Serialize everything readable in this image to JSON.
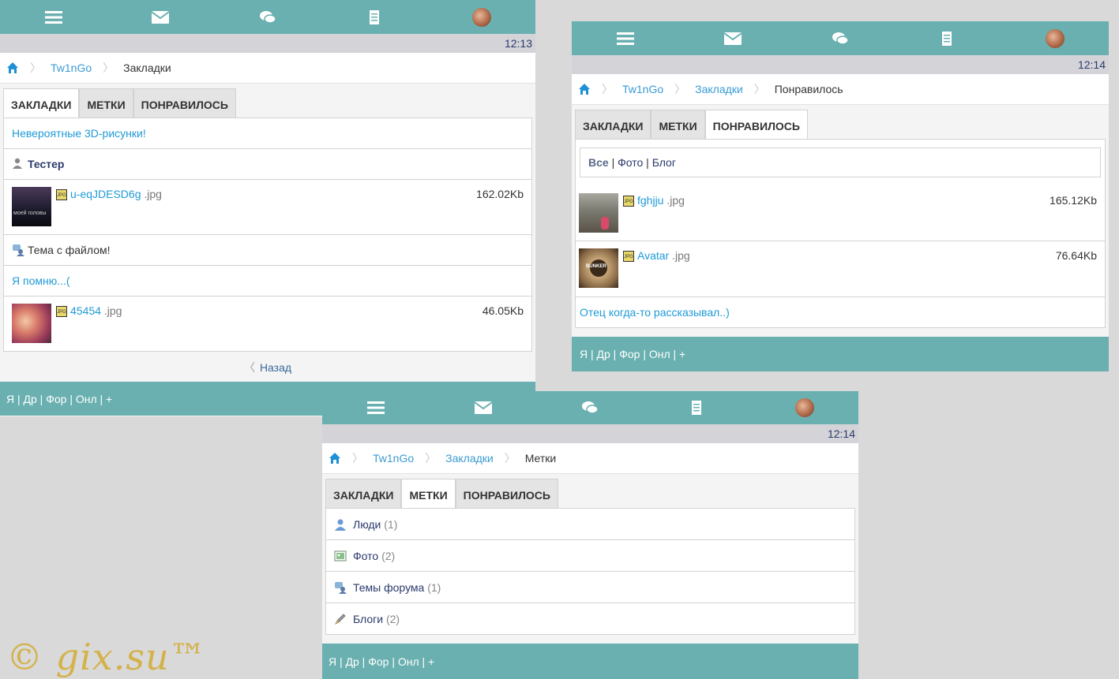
{
  "p1": {
    "time": "12:13",
    "breadcrumb": {
      "site": "Tw1nGo",
      "current": "Закладки"
    },
    "tabs": [
      "ЗАКЛАДКИ",
      "МЕТКИ",
      "ПОНРАВИЛОСЬ"
    ],
    "items": {
      "link1": "Невероятные 3D-рисунки!",
      "user": "Тестер",
      "file1": {
        "name": "u-eqJDESD6g",
        "ext": ".jpg",
        "size": "162.02Kb",
        "thumb_text": "моей головы"
      },
      "topic": "Тема с файлом!",
      "link2": "Я помню...(",
      "file2": {
        "name": "45454",
        "ext": ".jpg",
        "size": "46.05Kb"
      }
    },
    "back": "Назад",
    "footer": "Я | Др | Фор | Онл | +"
  },
  "p2": {
    "time": "12:14",
    "breadcrumb": {
      "site": "Tw1nGo",
      "mid": "Закладки",
      "current": "Понравилось"
    },
    "tabs": [
      "ЗАКЛАДКИ",
      "МЕТКИ",
      "ПОНРАВИЛОСЬ"
    ],
    "filter": {
      "all": "Все",
      "sep": "|",
      "photo": "Фото",
      "blog": "Блог"
    },
    "file1": {
      "name": "fghjju",
      "ext": ".jpg",
      "size": "165.12Kb"
    },
    "file2": {
      "name": "Avatar",
      "ext": ".jpg",
      "size": "76.64Kb",
      "thumb_text": "BUNKER"
    },
    "link": "Отец когда-то рассказывал..)",
    "footer": "Я | Др | Фор | Онл | +"
  },
  "p3": {
    "time": "12:14",
    "breadcrumb": {
      "site": "Tw1nGo",
      "mid": "Закладки",
      "current": "Метки"
    },
    "tabs": [
      "ЗАКЛАДКИ",
      "МЕТКИ",
      "ПОНРАВИЛОСЬ"
    ],
    "items": [
      {
        "label": "Люди",
        "count": "(1)"
      },
      {
        "label": "Фото",
        "count": "(2)"
      },
      {
        "label": "Темы форума",
        "count": "(1)"
      },
      {
        "label": "Блоги",
        "count": "(2)"
      }
    ],
    "footer": "Я | Др | Фор | Онл | +"
  },
  "file_icon_text": "JPG",
  "watermark": "© gix.su™",
  "colors": {
    "accent": "#6ab0b0",
    "link": "#1e9ad6",
    "timebar": "#d4d4d8"
  }
}
